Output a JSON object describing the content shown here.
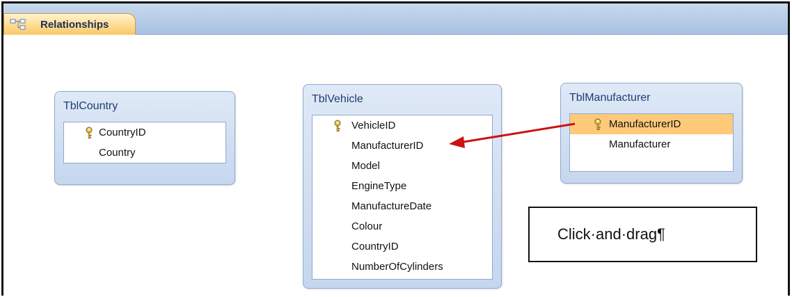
{
  "tab": {
    "label": "Relationships",
    "icon": "relationships-icon"
  },
  "tables": [
    {
      "title": "TblCountry",
      "fields": [
        {
          "name": "CountryID",
          "key": true,
          "selected": false
        },
        {
          "name": "Country",
          "key": false,
          "selected": false
        }
      ]
    },
    {
      "title": "TblVehicle",
      "fields": [
        {
          "name": "VehicleID",
          "key": true,
          "selected": false
        },
        {
          "name": "ManufacturerID",
          "key": false,
          "selected": false
        },
        {
          "name": "Model",
          "key": false,
          "selected": false
        },
        {
          "name": "EngineType",
          "key": false,
          "selected": false
        },
        {
          "name": "ManufactureDate",
          "key": false,
          "selected": false
        },
        {
          "name": "Colour",
          "key": false,
          "selected": false
        },
        {
          "name": "CountryID",
          "key": false,
          "selected": false
        },
        {
          "name": "NumberOfCylinders",
          "key": false,
          "selected": false
        }
      ]
    },
    {
      "title": "TblManufacturer",
      "fields": [
        {
          "name": "ManufacturerID",
          "key": true,
          "selected": true
        },
        {
          "name": "Manufacturer",
          "key": false,
          "selected": false
        }
      ]
    }
  ],
  "callout": {
    "text": "Click·and·drag¶"
  },
  "colors": {
    "selected_row": "#ffc97a",
    "arrow": "#cc1111",
    "tab_gold": "#ffd98c",
    "table_blue": "#c5d6ee"
  }
}
